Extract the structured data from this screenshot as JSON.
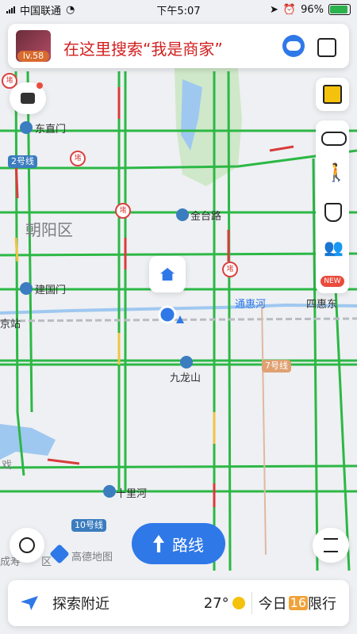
{
  "status_bar": {
    "carrier": "中国联通",
    "time": "下午5:07",
    "battery": "96%"
  },
  "search": {
    "level": "lv.58",
    "placeholder_text": "在这里搜索“我是商家”"
  },
  "map_labels": {
    "dongzhimen": "东直门",
    "jintailu": "金台路",
    "chaoyangqu": "朝阳区",
    "jianguomen": "建国门",
    "tonghuihe": "通惠河",
    "sihuidong": "四惠东",
    "jiulongshan": "九龙山",
    "shilihe": "十里河",
    "line2": "2号线",
    "line7": "7号线",
    "line10": "10号线",
    "watermark": "高德地图",
    "left_edge_1": "京站",
    "left_edge_2": "戏",
    "left_edge_3": "成寿",
    "left_edge_4": "区"
  },
  "markers": {
    "block": "堵"
  },
  "right_panel": {
    "new_badge": "NEW"
  },
  "route_button": {
    "label": "路线"
  },
  "bottom_bar": {
    "explore": "探索附近",
    "temperature": "27°",
    "today": "今日",
    "restriction_number": "16",
    "restriction_label": "限行"
  },
  "colors": {
    "road_green": "#2cb845",
    "road_red": "#d93b3b",
    "road_yellow": "#f0c341",
    "water": "#9fc8f0",
    "park": "#cfe8c9",
    "brand_blue": "#2f78e8"
  },
  "icons": {
    "chat": "chat-icon",
    "layers": "layers-icon",
    "traffic": "traffic-light-icon",
    "walker": "walker-icon",
    "shield": "shield-plus-icon",
    "people": "people-icon",
    "locate": "locate-icon",
    "list": "list-icon",
    "send": "send-icon",
    "home": "home-icon",
    "robot": "robot-icon",
    "scan": "scan-icon"
  }
}
